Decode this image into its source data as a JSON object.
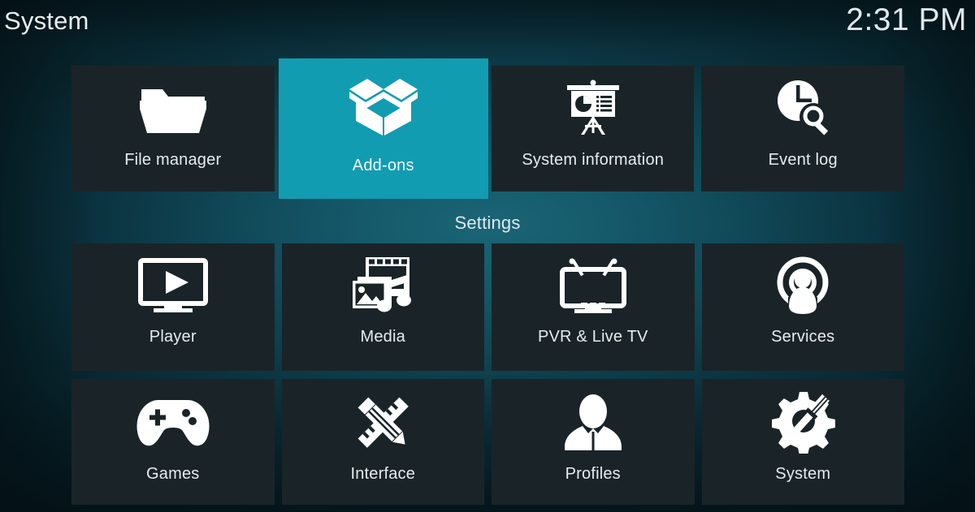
{
  "header": {
    "title": "System",
    "clock": "2:31 PM"
  },
  "colors": {
    "accent": "#129cb1",
    "tile_bg": "#1a2428",
    "text": "#e6ecee",
    "background_center": "#155a6b",
    "background_edge": "#061d25"
  },
  "sections": {
    "settings_label": "Settings"
  },
  "top_row": [
    {
      "label": "File manager",
      "icon": "folder-icon",
      "focused": false
    },
    {
      "label": "Add-ons",
      "icon": "open-box-icon",
      "focused": true
    },
    {
      "label": "System information",
      "icon": "presentation-icon",
      "focused": false
    },
    {
      "label": "Event log",
      "icon": "clock-search-icon",
      "focused": false
    }
  ],
  "settings_rows": [
    [
      {
        "label": "Player",
        "icon": "monitor-play-icon",
        "focused": false
      },
      {
        "label": "Media",
        "icon": "media-library-icon",
        "focused": false
      },
      {
        "label": "PVR & Live TV",
        "icon": "tv-antenna-icon",
        "focused": false
      },
      {
        "label": "Services",
        "icon": "podcast-person-icon",
        "focused": false
      }
    ],
    [
      {
        "label": "Games",
        "icon": "gamepad-icon",
        "focused": false
      },
      {
        "label": "Interface",
        "icon": "pencil-ruler-icon",
        "focused": false
      },
      {
        "label": "Profiles",
        "icon": "person-bust-icon",
        "focused": false
      },
      {
        "label": "System",
        "icon": "gear-wrench-icon",
        "focused": false
      }
    ]
  ]
}
